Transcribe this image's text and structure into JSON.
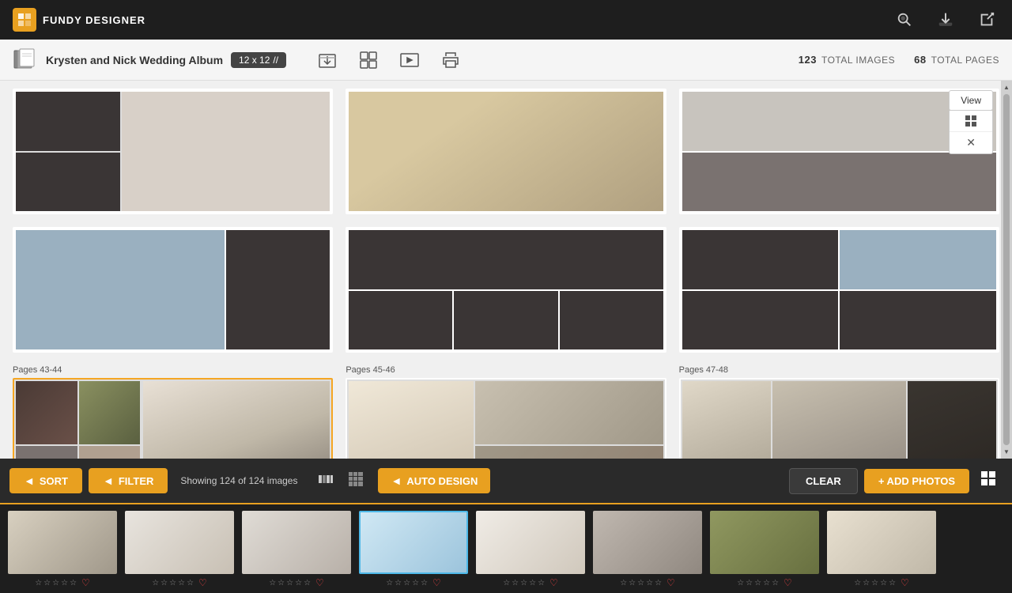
{
  "app": {
    "title": "FUNDY DESIGNER"
  },
  "header": {
    "search_icon": "🔍",
    "cart_icon": "⬇",
    "external_icon": "↗"
  },
  "toolbar": {
    "project_name": "Krysten and Nick Wedding Album",
    "size": "12 x 12",
    "size_icon": "//",
    "icon1": "⬇",
    "icon2": "▦",
    "icon3": "▤",
    "icon4": "⚓",
    "total_images_num": "123",
    "total_images_label": "TOTAL IMAGES",
    "total_pages_num": "68",
    "total_pages_label": "TOTAL PAGES"
  },
  "pages": [
    {
      "label": "",
      "id": "prev-1",
      "layout": "left-small-right-large"
    },
    {
      "label": "",
      "id": "prev-2",
      "layout": "single"
    },
    {
      "label": "",
      "id": "prev-3",
      "layout": "collage"
    },
    {
      "label": "",
      "id": "prev-4",
      "layout": "two-col"
    },
    {
      "label": "",
      "id": "prev-5",
      "layout": "right-panel"
    }
  ],
  "page_spreads": [
    {
      "label": "Pages 43-44",
      "selected": true
    },
    {
      "label": "Pages 45-46",
      "selected": false
    },
    {
      "label": "Pages 47-48",
      "selected": false
    }
  ],
  "view_popup": {
    "view_label": "View",
    "grid_icon": "⊞",
    "close_icon": "✕"
  },
  "bottom_toolbar": {
    "sort_label": "SORT",
    "filter_label": "FILTER",
    "showing_text": "Showing 124 of 124 images",
    "auto_design_label": "AUTO DESIGN",
    "clear_label": "CLEAR",
    "add_photos_label": "+ ADD PHOTOS"
  },
  "filmstrip": {
    "photos": [
      {
        "id": 1,
        "selected": false,
        "color": "ph-light",
        "stars": 0
      },
      {
        "id": 2,
        "selected": false,
        "color": "ph-white",
        "stars": 0
      },
      {
        "id": 3,
        "selected": false,
        "color": "ph-wed",
        "stars": 0
      },
      {
        "id": 4,
        "selected": true,
        "color": "ph-blue",
        "stars": 0
      },
      {
        "id": 5,
        "selected": false,
        "color": "ph-white",
        "stars": 0
      },
      {
        "id": 6,
        "selected": false,
        "color": "ph-light",
        "stars": 0
      },
      {
        "id": 7,
        "selected": false,
        "color": "ph-outdoor",
        "stars": 0
      },
      {
        "id": 8,
        "selected": false,
        "color": "ph-cream",
        "stars": 0
      }
    ]
  }
}
